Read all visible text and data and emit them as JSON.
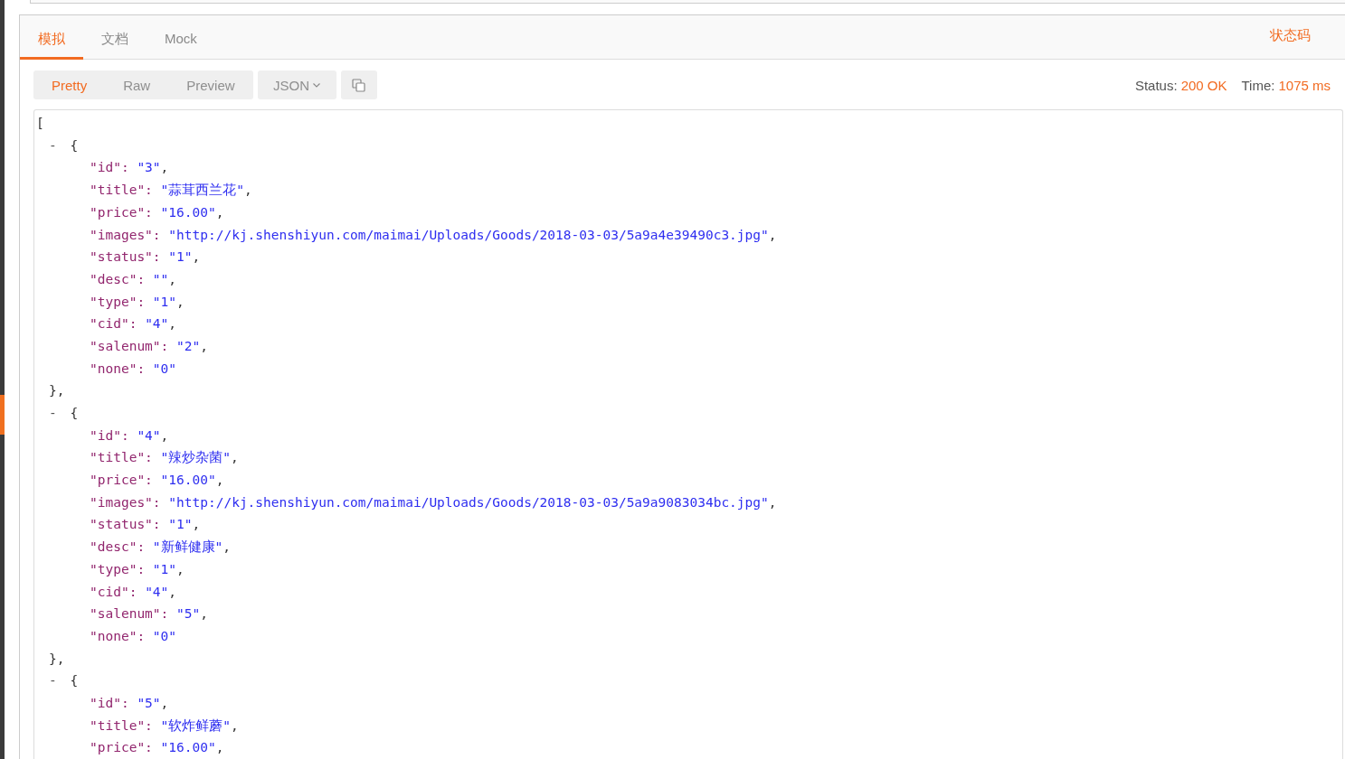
{
  "tabs": [
    {
      "label": "模拟",
      "selected": true
    },
    {
      "label": "文档",
      "selected": false
    },
    {
      "label": "Mock",
      "selected": false
    }
  ],
  "side_link": "状态码",
  "views": [
    {
      "label": "Pretty",
      "selected": true
    },
    {
      "label": "Raw",
      "selected": false
    },
    {
      "label": "Preview",
      "selected": false
    }
  ],
  "format": "JSON",
  "status": {
    "label": "Status:",
    "value": "200 OK"
  },
  "time": {
    "label": "Time:",
    "value": "1075 ms"
  },
  "response_body": {
    "open": "[",
    "objects": [
      {
        "toggle": "-",
        "open": "{",
        "fields": [
          {
            "key": "\"id\":",
            "value": "\"3\"",
            "punct": ","
          },
          {
            "key": "\"title\":",
            "value": "\"蒜茸西兰花\"",
            "punct": ","
          },
          {
            "key": "\"price\":",
            "value": "\"16.00\"",
            "punct": ","
          },
          {
            "key": "\"images\":",
            "value": "\"http://kj.shenshiyun.com/maimai/Uploads/Goods/2018-03-03/5a9a4e39490c3.jpg\"",
            "punct": ","
          },
          {
            "key": "\"status\":",
            "value": "\"1\"",
            "punct": ","
          },
          {
            "key": "\"desc\":",
            "value": "\"\"",
            "punct": ","
          },
          {
            "key": "\"type\":",
            "value": "\"1\"",
            "punct": ","
          },
          {
            "key": "\"cid\":",
            "value": "\"4\"",
            "punct": ","
          },
          {
            "key": "\"salenum\":",
            "value": "\"2\"",
            "punct": ","
          },
          {
            "key": "\"none\":",
            "value": "\"0\""
          }
        ],
        "close": "},"
      },
      {
        "toggle": "-",
        "open": "{",
        "fields": [
          {
            "key": "\"id\":",
            "value": "\"4\"",
            "punct": ","
          },
          {
            "key": "\"title\":",
            "value": "\"辣炒杂菌\"",
            "punct": ","
          },
          {
            "key": "\"price\":",
            "value": "\"16.00\"",
            "punct": ","
          },
          {
            "key": "\"images\":",
            "value": "\"http://kj.shenshiyun.com/maimai/Uploads/Goods/2018-03-03/5a9a9083034bc.jpg\"",
            "punct": ","
          },
          {
            "key": "\"status\":",
            "value": "\"1\"",
            "punct": ","
          },
          {
            "key": "\"desc\":",
            "value": "\"新鲜健康\"",
            "punct": ","
          },
          {
            "key": "\"type\":",
            "value": "\"1\"",
            "punct": ","
          },
          {
            "key": "\"cid\":",
            "value": "\"4\"",
            "punct": ","
          },
          {
            "key": "\"salenum\":",
            "value": "\"5\"",
            "punct": ","
          },
          {
            "key": "\"none\":",
            "value": "\"0\""
          }
        ],
        "close": "},"
      },
      {
        "toggle": "-",
        "open": "{",
        "fields": [
          {
            "key": "\"id\":",
            "value": "\"5\"",
            "punct": ","
          },
          {
            "key": "\"title\":",
            "value": "\"软炸鲜蘑\"",
            "punct": ","
          },
          {
            "key": "\"price\":",
            "value": "\"16.00\"",
            "punct": ","
          }
        ]
      }
    ]
  }
}
